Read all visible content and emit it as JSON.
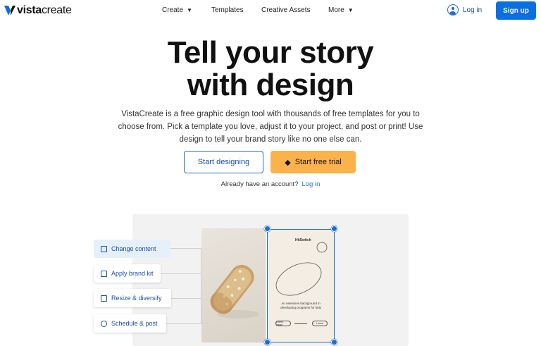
{
  "brand": {
    "logo_text_bold": "vista",
    "logo_text_light": "create",
    "accent": "#0a6fe0",
    "cta_orange": "#fbb24a"
  },
  "nav": {
    "items": [
      {
        "label": "Create",
        "dropdown": true
      },
      {
        "label": "Templates",
        "dropdown": false
      },
      {
        "label": "Creative Assets",
        "dropdown": false
      },
      {
        "label": "More",
        "dropdown": true
      }
    ],
    "login": "Log in",
    "signup": "Sign up"
  },
  "hero": {
    "title_line1": "Tell your story",
    "title_line2": "with design",
    "description": "VistaCreate is a free graphic design tool with thousands of free templates for you to choose from. Pick a template you love, adjust it to your project, and post or print! Use design to tell your brand story like no one else can.",
    "primary_cta": "Start designing",
    "trial_cta": "Start free trial",
    "account_prompt": "Already have an account?",
    "account_link": "Log in"
  },
  "demo": {
    "features": [
      {
        "label": "Change content",
        "icon": "crop-icon"
      },
      {
        "label": "Apply brand kit",
        "icon": "briefcase-icon"
      },
      {
        "label": "Resize & diversify",
        "icon": "resize-icon"
      },
      {
        "label": "Schedule & post",
        "icon": "clock-icon"
      }
    ],
    "card": {
      "brand": "HitSwitch",
      "text": "An extensive background in developing programs for kids",
      "pill_left": "Lorem ipsum",
      "pill_right": "Lorem"
    }
  }
}
